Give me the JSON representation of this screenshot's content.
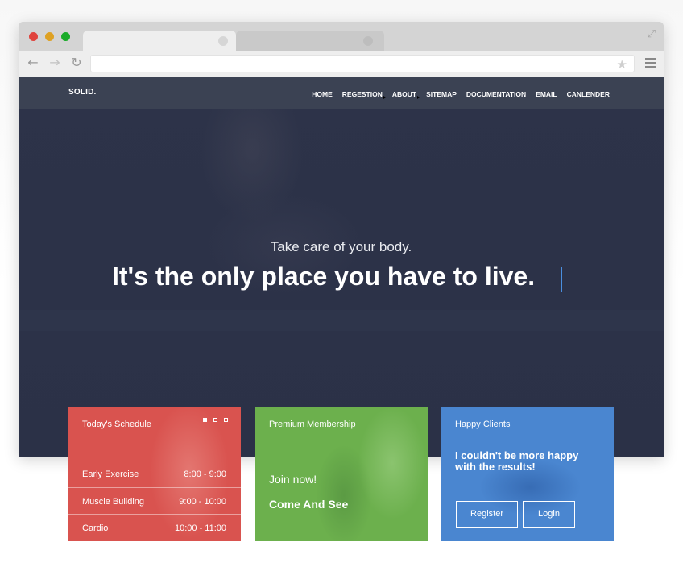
{
  "site": {
    "logo": "SOLID.",
    "nav": [
      "HOME",
      "REGESTION",
      "ABOUT",
      "SITEMAP",
      "DOCUMENTATION",
      "EMAIL",
      "CANLENDER"
    ]
  },
  "hero": {
    "subtitle": "Take care of your body.",
    "title": "It's the only place you have to live."
  },
  "cards": {
    "schedule": {
      "heading": "Today's Schedule",
      "rows": [
        {
          "name": "Early Exercise",
          "time": "8:00 - 9:00"
        },
        {
          "name": "Muscle Building",
          "time": "9:00 - 10:00"
        },
        {
          "name": "Cardio",
          "time": "10:00 - 11:00"
        }
      ],
      "color": "#d9534f"
    },
    "membership": {
      "heading": "Premium Membership",
      "join": "Join now!",
      "cta": "Come And See",
      "color": "#6cb04d"
    },
    "clients": {
      "heading": "Happy Clients",
      "quote": "I couldn't be more happy with the results!",
      "register": "Register",
      "login": "Login",
      "color": "#4a86d0"
    }
  },
  "icons": [
    "back-arrow-icon",
    "forward-arrow-icon",
    "reload-icon",
    "star-icon",
    "menu-icon",
    "expand-icon"
  ]
}
